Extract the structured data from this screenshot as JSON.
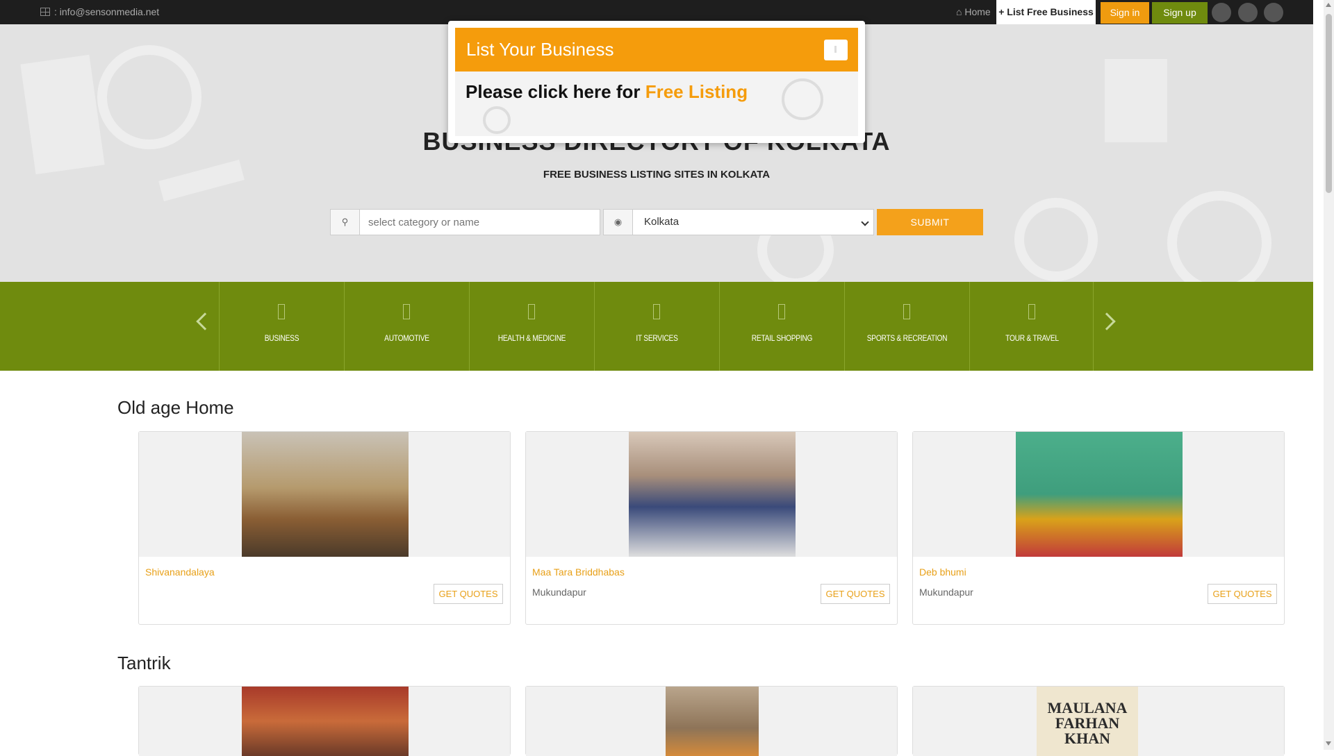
{
  "topbar": {
    "email": ": info@sensonmedia.net",
    "nav": {
      "home": "Home",
      "list_free_business": "List Free Business",
      "sign_in": "Sign in",
      "sign_up": "Sign up"
    }
  },
  "hero": {
    "title": "BUSINESS DIRECTORY OF KOLKATA",
    "subtitle": "FREE BUSINESS LISTING SITES IN KOLKATA",
    "search": {
      "placeholder": "select category or name",
      "city_selected": "Kolkata",
      "submit_label": "SUBMIT"
    }
  },
  "modal": {
    "title": "List Your Business",
    "body_prefix": "Please click here for ",
    "body_highlight": "Free Listing"
  },
  "categories": [
    {
      "label": "BUSINESS"
    },
    {
      "label": "AUTOMOTIVE"
    },
    {
      "label": "HEALTH & MEDICINE"
    },
    {
      "label": "IT SERVICES"
    },
    {
      "label": "RETAIL SHOPPING"
    },
    {
      "label": "SPORTS & RECREATION"
    },
    {
      "label": "TOUR & TRAVEL"
    }
  ],
  "sections": [
    {
      "title": "Old age Home",
      "cards": [
        {
          "name": "Shivanandalaya",
          "location": "",
          "button": "GET QUOTES"
        },
        {
          "name": "Maa Tara Briddhabas",
          "location": "Mukundapur",
          "button": "GET QUOTES"
        },
        {
          "name": "Deb bhumi",
          "location": "Mukundapur",
          "button": "GET QUOTES"
        }
      ]
    },
    {
      "title": "Tantrik",
      "cards": [
        {
          "image_text": ""
        },
        {
          "image_text": ""
        },
        {
          "image_text": "MAULANA FARHAN KHAN"
        }
      ]
    }
  ],
  "colors": {
    "accent_orange": "#f59c0c",
    "category_green": "#6f8b0e",
    "signup_green": "#6f8b0e",
    "topbar": "#1e1e1e"
  }
}
